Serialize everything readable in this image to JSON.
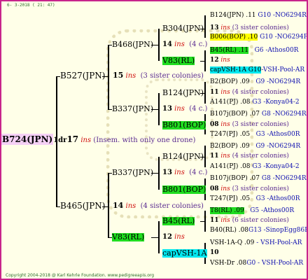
{
  "timestamp": "6- 3-2018 ( 21: 47)",
  "root": {
    "name": "B724(JPN)",
    "year": "1dr",
    "num": "17",
    "ins": "ins",
    "note": "(Insem. with only one drone)"
  },
  "gen1": [
    {
      "name": "B527(JPN)",
      "num": "15",
      "ins": "ins",
      "note": "(3 sister colonies)"
    },
    {
      "name": "B465(JPN)",
      "num": "14",
      "ins": "ins",
      "note": "(4 sister colonies)"
    }
  ],
  "gen2": [
    {
      "name": "B468(JPN)",
      "num": "14",
      "ins": "ins",
      "note": "(4 c.)"
    },
    {
      "name": "B337(JPN)",
      "num": "13",
      "ins": "ins",
      "note": "(4 c.)"
    },
    {
      "name": "B337(JPN)",
      "num": "13",
      "ins": "ins",
      "note": "(4 c.)"
    },
    {
      "name": "V83(RL)",
      "num": "12",
      "ins": "ins",
      "note": ""
    }
  ],
  "gen3": [
    {
      "name": "B304(JPN)"
    },
    {
      "name": "V83(RL)"
    },
    {
      "name": "B124(JPN)"
    },
    {
      "name": "B801(BOP)"
    },
    {
      "name": "B124(JPN)"
    },
    {
      "name": "B801(BOP)"
    },
    {
      "name": "B45(RL)"
    },
    {
      "name": "capVSH-1A"
    }
  ],
  "gen4": [
    {
      "a": "B124(JPN) .11",
      "b": "G10 -NO6294R"
    },
    {
      "a": "13",
      "b": "ins",
      "c": "(3 sister colonies)"
    },
    {
      "a": "B006(BOP) .10",
      "b": "G10 -NO6294R"
    },
    {
      "a": "B45(RL) .11",
      "b": "G6 -Athos00R"
    },
    {
      "a": "12",
      "b": "ins"
    },
    {
      "a": "capVSH-1A G10",
      "b": "-VSH-Pool-AR"
    },
    {
      "a": "B2(BOP) .09",
      "b": "G9 -NO6294R"
    },
    {
      "a": "11",
      "b": "ins",
      "c": "(4 sister colonies)"
    },
    {
      "a": "A141(PJ) .08",
      "b": "G3 -Konya04-2"
    },
    {
      "a": "B107j(BOP) .07",
      "b": "G8 -NO6294R"
    },
    {
      "a": "08",
      "b": "ins",
      "c": "(3 sister colonies)"
    },
    {
      "a": "T247(PJ) .05",
      "b": "G3 -Athos00R"
    },
    {
      "a": "B2(BOP) .09",
      "b": "G9 -NO6294R"
    },
    {
      "a": "11",
      "b": "ins",
      "c": "(4 sister colonies)"
    },
    {
      "a": "A141(PJ) .08",
      "b": "G3 -Konya04-2"
    },
    {
      "a": "B107j(BOP) .07",
      "b": "G8 -NO6294R"
    },
    {
      "a": "08",
      "b": "ins",
      "c": "(3 sister colonies)"
    },
    {
      "a": "T247(PJ) .05",
      "b": "G3 -Athos00R"
    },
    {
      "a": "T8(RL) .09",
      "b": "G5 -Athos00R"
    },
    {
      "a": "11",
      "b": "ins",
      "c": "(6 sister colonies)"
    },
    {
      "a": "B40(RL) .08",
      "b": "G13 -SinopEgg86R"
    },
    {
      "a": "VSH-1A-Q .09",
      "b": "- VSH-Pool-AR"
    },
    {
      "a": "10",
      "b": ""
    },
    {
      "a": "VSH-Dr .08",
      "b": "G0 - VSH-Pool-AR"
    }
  ],
  "footer": "Copyright 2004-2018 @ Karl Kehrle Foundation.   www.pedigreeapis.org"
}
